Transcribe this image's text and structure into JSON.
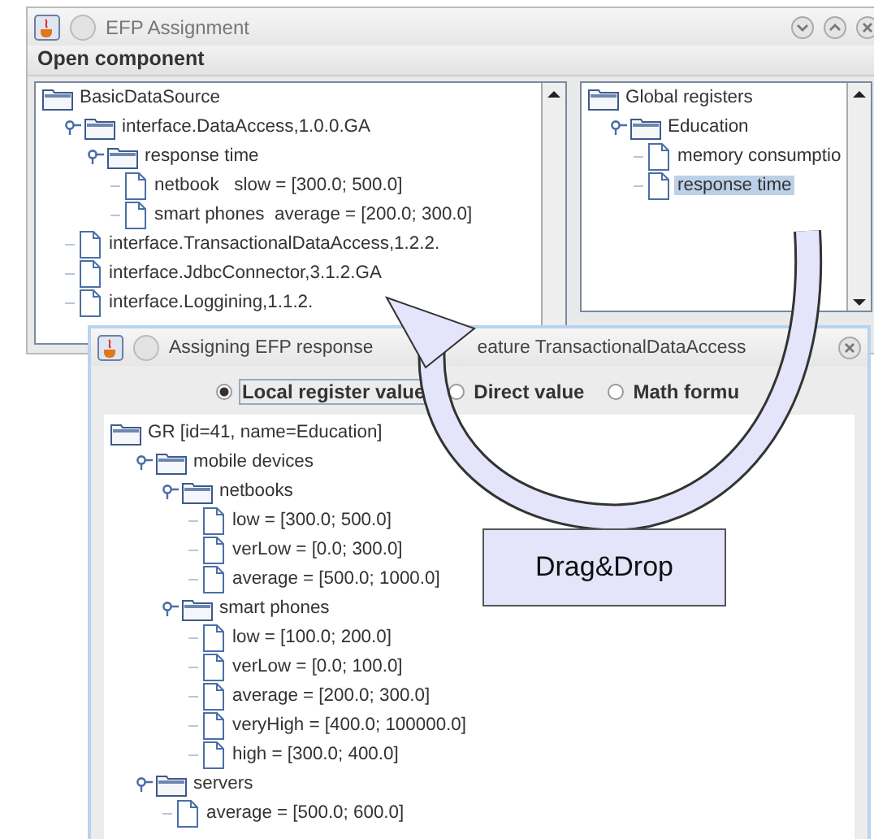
{
  "window": {
    "title": "EFP Assignment",
    "header": "Open component"
  },
  "component_tree": [
    {
      "label": "BasicDataSource",
      "kind": "folder",
      "selected": false,
      "children": [
        {
          "label": "interface.DataAccess,1.0.0.GA",
          "kind": "folder",
          "expanded": true,
          "selected": false,
          "children": [
            {
              "label": "response time",
              "kind": "folder",
              "expanded": true,
              "selected": false,
              "children": [
                {
                  "label": "netbook   slow = [300.0; 500.0]",
                  "kind": "leaf",
                  "selected": false
                },
                {
                  "label": "smart phones  average = [200.0; 300.0]",
                  "kind": "leaf",
                  "selected": false
                }
              ]
            }
          ]
        },
        {
          "label": "interface.TransactionalDataAccess,1.2.2.",
          "kind": "leaf",
          "selected": false
        },
        {
          "label": "interface.JdbcConnector,3.1.2.GA",
          "kind": "leaf",
          "selected": false
        },
        {
          "label": "interface.Loggining,1.1.2.",
          "kind": "leaf",
          "selected": false
        }
      ]
    }
  ],
  "registers_tree": [
    {
      "label": "Global registers",
      "kind": "folder",
      "selected": false,
      "children": [
        {
          "label": "Education",
          "kind": "folder",
          "expanded": true,
          "selected": false,
          "children": [
            {
              "label": "memory consumptio",
              "kind": "leaf",
              "selected": false
            },
            {
              "label": "response time",
              "kind": "leaf",
              "selected": true
            }
          ]
        }
      ]
    }
  ],
  "dialog": {
    "title_start": "Assigning EFP response",
    "title_end": "eature TransactionalDataAccess",
    "options": [
      {
        "label": "Local register value",
        "selected": true
      },
      {
        "label": "Direct value",
        "selected": false
      },
      {
        "label": "Math formu",
        "selected": false
      }
    ],
    "tree": [
      {
        "label": "GR [id=41, name=Education]",
        "kind": "folder",
        "selected": false,
        "children": [
          {
            "label": "mobile devices",
            "kind": "folder",
            "expanded": true,
            "selected": false,
            "children": [
              {
                "label": "netbooks",
                "kind": "folder",
                "expanded": true,
                "selected": false,
                "children": [
                  {
                    "label": "low = [300.0; 500.0]",
                    "kind": "leaf",
                    "selected": false
                  },
                  {
                    "label": "verLow = [0.0; 300.0]",
                    "kind": "leaf",
                    "selected": false
                  },
                  {
                    "label": "average = [500.0; 1000.0]",
                    "kind": "leaf",
                    "selected": false
                  }
                ]
              },
              {
                "label": "smart phones",
                "kind": "folder",
                "expanded": true,
                "selected": false,
                "children": [
                  {
                    "label": "low = [100.0; 200.0]",
                    "kind": "leaf",
                    "selected": false
                  },
                  {
                    "label": "verLow = [0.0; 100.0]",
                    "kind": "leaf",
                    "selected": false
                  },
                  {
                    "label": "average = [200.0; 300.0]",
                    "kind": "leaf",
                    "selected": false
                  },
                  {
                    "label": "veryHigh = [400.0; 100000.0]",
                    "kind": "leaf",
                    "selected": false
                  },
                  {
                    "label": "high = [300.0; 400.0]",
                    "kind": "leaf",
                    "selected": false
                  }
                ]
              }
            ]
          },
          {
            "label": "servers",
            "kind": "folder",
            "expanded": true,
            "selected": false,
            "children": [
              {
                "label": "average = [500.0; 600.0]",
                "kind": "leaf",
                "selected": false
              }
            ]
          }
        ]
      }
    ]
  },
  "callout": {
    "label": "Drag&Drop"
  }
}
